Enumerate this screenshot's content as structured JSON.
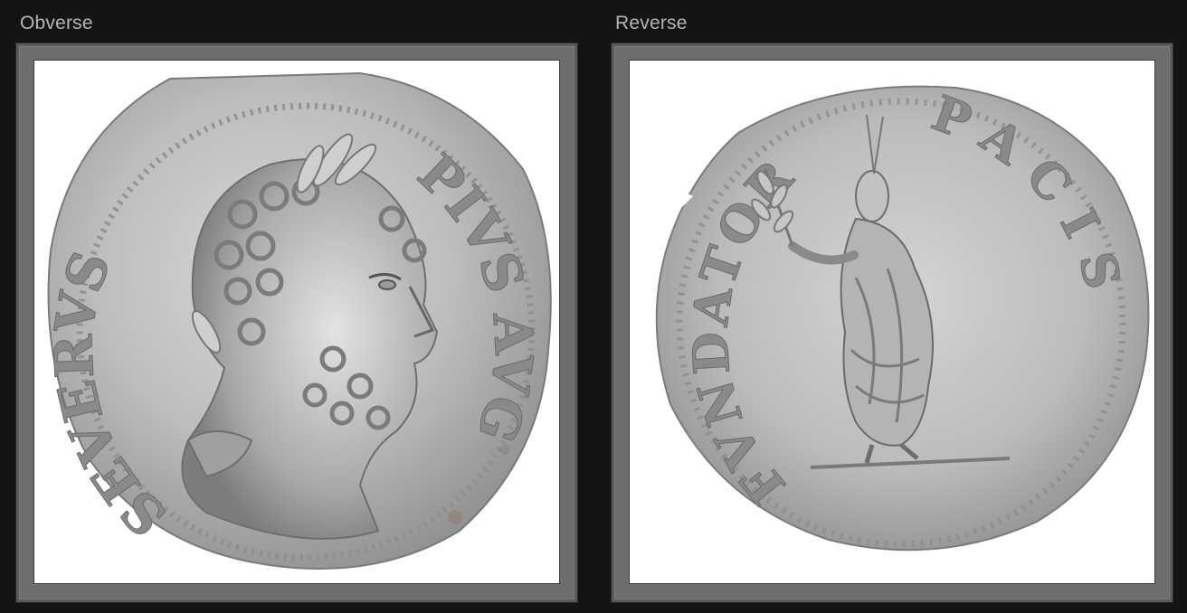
{
  "obverse": {
    "title": "Obverse",
    "legend": [
      "SEVERVS",
      "PIVS AVG"
    ]
  },
  "reverse": {
    "title": "Reverse",
    "legend": [
      "FVNDATOR",
      "PACIS"
    ]
  },
  "colors": {
    "background": "#141414",
    "frame": "#6d6d6d",
    "title_text": "#b4b4b4",
    "coin_silver": "#c9c9c9"
  },
  "icons": {
    "obverse_image": "laureate-bust-of-emperor",
    "reverse_image": "togate-figure-holding-branch"
  }
}
